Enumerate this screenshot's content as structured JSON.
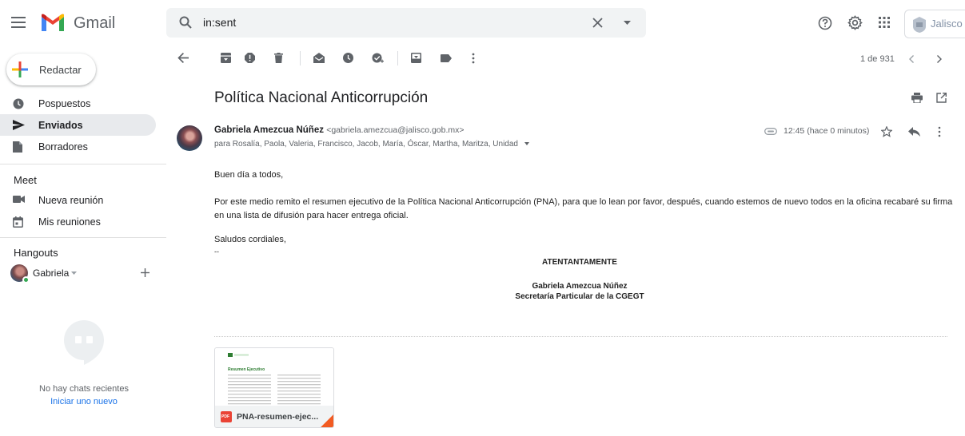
{
  "app": {
    "name": "Gmail",
    "brand_colors": {
      "red": "#ea4335",
      "blue": "#4285f4",
      "yellow": "#fbbc04",
      "green": "#34a853"
    }
  },
  "search": {
    "value": "in:sent"
  },
  "account": {
    "org_label": "Jalisco"
  },
  "sidebar": {
    "compose_label": "Redactar",
    "items": [
      {
        "label": "Pospuestos",
        "icon": "clock-icon"
      },
      {
        "label": "Enviados",
        "icon": "send-icon",
        "active": true
      },
      {
        "label": "Borradores",
        "icon": "draft-icon"
      }
    ],
    "meet": {
      "title": "Meet",
      "items": [
        {
          "label": "Nueva reunión",
          "icon": "video-icon"
        },
        {
          "label": "Mis reuniones",
          "icon": "calendar-icon"
        }
      ]
    },
    "hangouts": {
      "title": "Hangouts",
      "user_name": "Gabriela",
      "empty_text": "No hay chats recientes",
      "start_link": "Iniciar uno nuevo"
    }
  },
  "toolbar": {
    "page_count": "1 de 931"
  },
  "message": {
    "subject": "Política Nacional Anticorrupción",
    "sender_name": "Gabriela Amezcua Núñez",
    "sender_email": "<gabriela.amezcua@jalisco.gob.mx>",
    "recipients": "para Rosalía, Paola, Valeria, Francisco, Jacob, María, Óscar, Martha, Maritza, Unidad",
    "time": "12:45 (hace 0 minutos)",
    "greeting": "Buen día a todos,",
    "body_line1": "Por este medio remito el resumen ejecutivo de la Política Nacional Anticorrupción (PNA), para que lo lean por favor, después, cuando estemos de nuevo todos en la oficina recabaré su firma",
    "body_line2": "en una lista de difusión para hacer entrega oficial.",
    "closing": "Saludos cordiales,",
    "sig_sep": "--",
    "sig_title": "ATENTANTAMENTE",
    "sig_name": "Gabriela Amezcua Núñez",
    "sig_role": "Secretaría Particular de la CGEGT"
  },
  "attachment": {
    "file_name": "PNA-resumen-ejec...",
    "type_badge": "PDF",
    "preview_heading": "Resumen Ejecutivo"
  }
}
